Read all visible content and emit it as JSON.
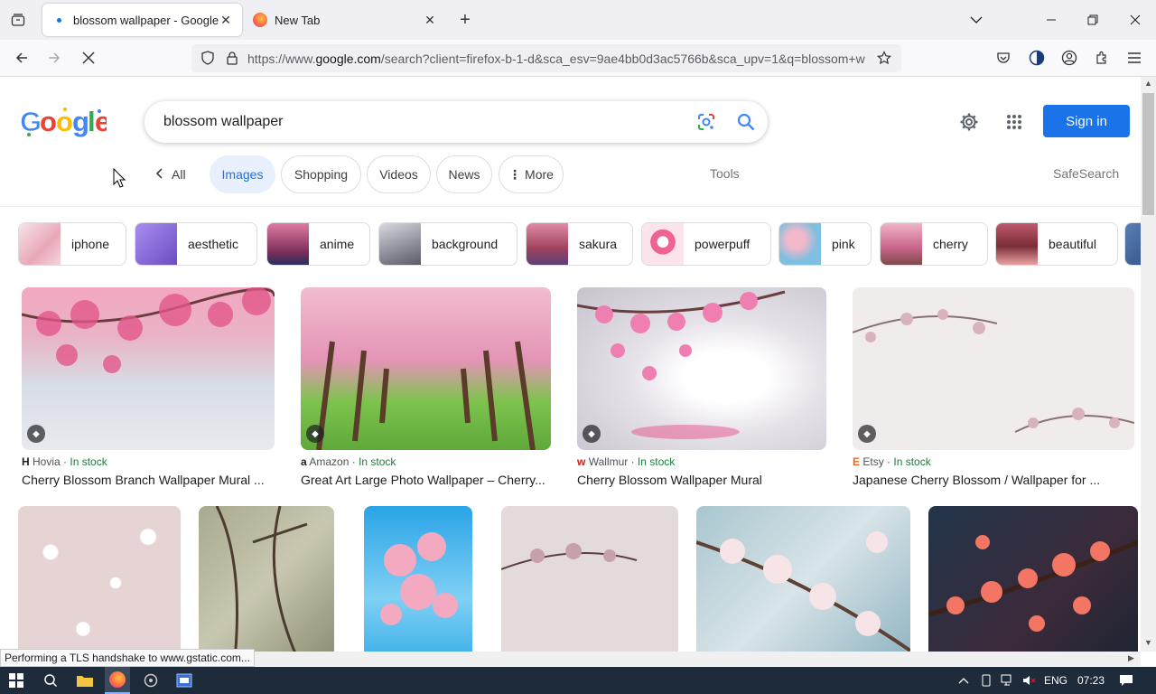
{
  "browser": {
    "tabs": [
      {
        "title": "blossom wallpaper - Google Search",
        "active": true
      },
      {
        "title": "New Tab",
        "active": false
      }
    ],
    "url_prefix": "https://www.",
    "url_domain": "google.com",
    "url_rest": "/search?client=firefox-b-1-d&sca_esv=9ae4bb0d3ac5766b&sca_upv=1&q=blossom+w",
    "status": "Performing a TLS handshake to www.gstatic.com..."
  },
  "google": {
    "logo": "Google",
    "query": "blossom wallpaper",
    "sign_in": "Sign in",
    "nav": [
      {
        "label": "All",
        "selected": false
      },
      {
        "label": "Images",
        "selected": true
      },
      {
        "label": "Shopping",
        "selected": false
      },
      {
        "label": "Videos",
        "selected": false
      },
      {
        "label": "News",
        "selected": false
      },
      {
        "label": "More",
        "selected": false
      }
    ],
    "tools": "Tools",
    "safesearch": "SafeSearch",
    "related": [
      {
        "label": "iphone",
        "color": "#f2d0d8"
      },
      {
        "label": "aesthetic",
        "color": "#8c6fd1"
      },
      {
        "label": "anime",
        "color": "#c9577e"
      },
      {
        "label": "background",
        "color": "#9a9aa6"
      },
      {
        "label": "sakura",
        "color": "#b9657c"
      },
      {
        "label": "powerpuff",
        "color": "#f48aa8"
      },
      {
        "label": "pink",
        "color": "#8fc6dd"
      },
      {
        "label": "cherry",
        "color": "#d88ea6"
      },
      {
        "label": "beautiful",
        "color": "#a3484e"
      }
    ],
    "results": [
      {
        "source": "Hovia",
        "stock": "In stock",
        "title": "Cherry Blossom Branch Wallpaper Mural ..."
      },
      {
        "source": "Amazon",
        "stock": "In stock",
        "title": "Great Art Large Photo Wallpaper – Cherry..."
      },
      {
        "source": "Wallmur",
        "stock": "In stock",
        "title": "Cherry Blossom Wallpaper Mural"
      },
      {
        "source": "Etsy",
        "stock": "In stock",
        "title": "Japanese Cherry Blossom / Wallpaper for ..."
      }
    ]
  },
  "taskbar": {
    "lang": "ENG",
    "time": "07:23"
  }
}
